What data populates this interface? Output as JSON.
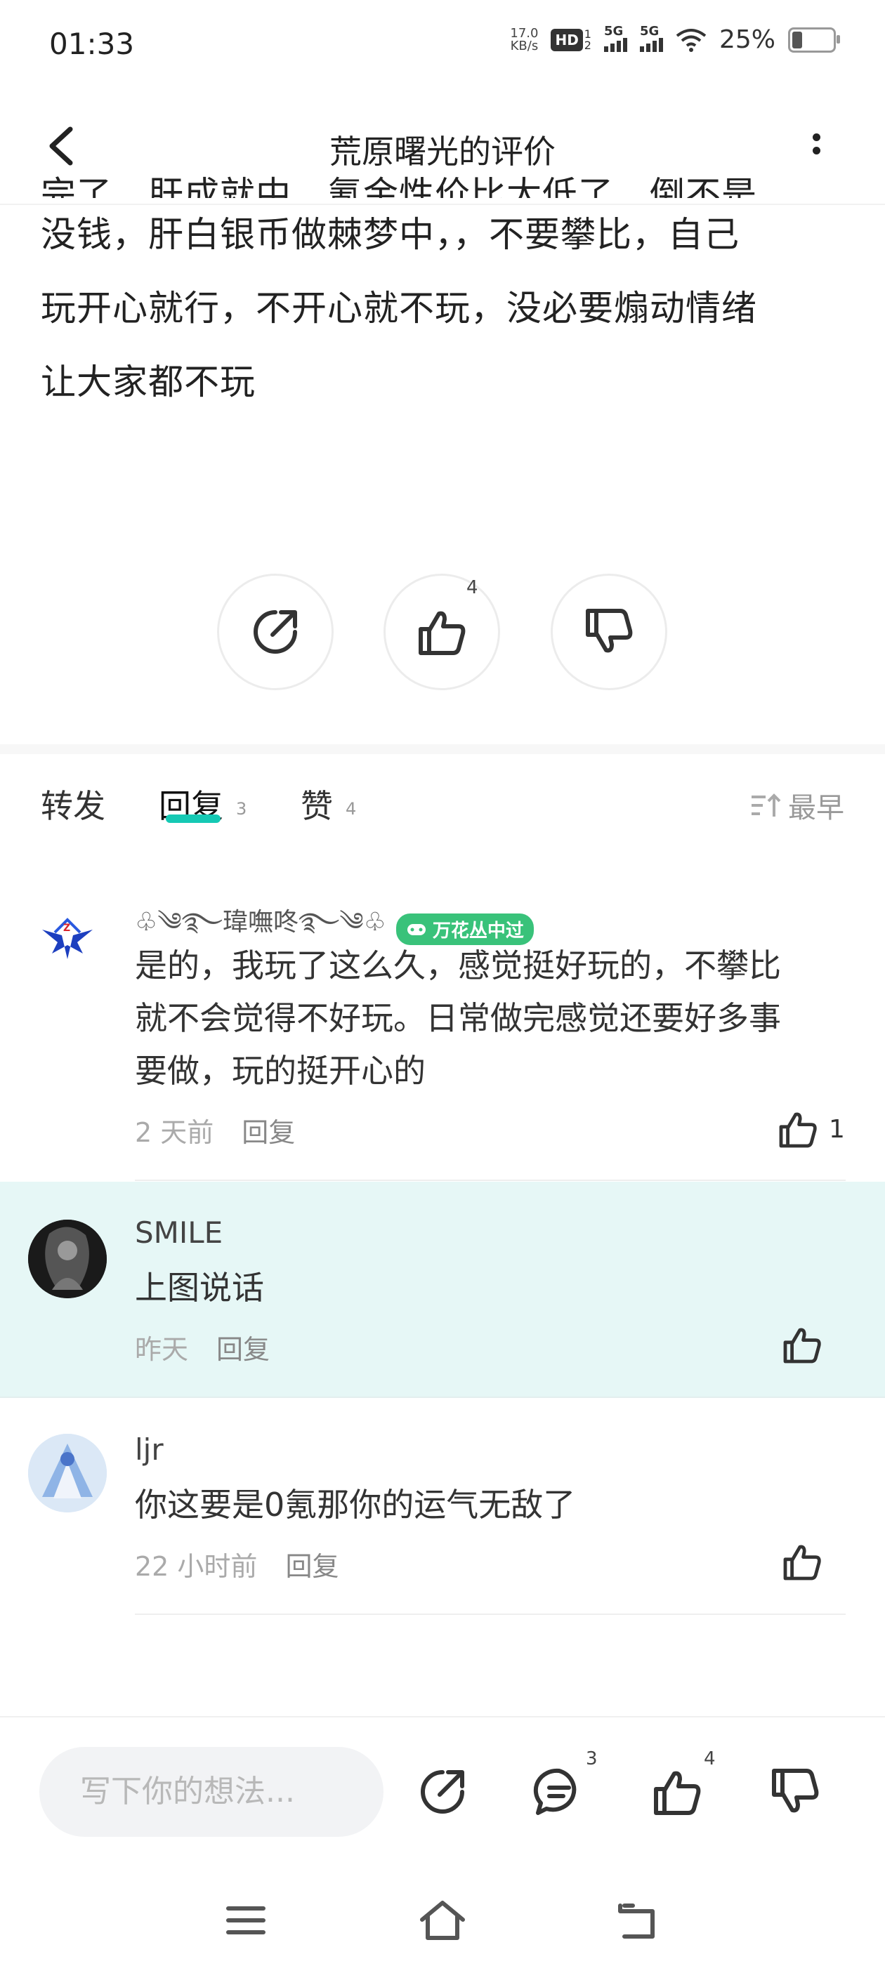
{
  "status_bar": {
    "time": "01:33",
    "net_speed_value": "17.0",
    "net_speed_unit": "KB/s",
    "hd_label": "HD",
    "hd_sub": "1",
    "hd_sub2": "2",
    "sim1": "5G",
    "sim2": "5G",
    "battery": "25%"
  },
  "header": {
    "title": "荒原曙光的评价",
    "back_icon": "chevron-left-icon",
    "more_icon": "more-vertical-icon"
  },
  "review": {
    "partial_line": "完了，肝成就中，氪金性价比太低了，倒不是",
    "lines": [
      "没钱，肝白银币做棘梦中，，不要攀比，自己",
      "玩开心就行，不开心就不玩，没必要煽动情绪",
      "让大家都不玩"
    ]
  },
  "actions": {
    "share_icon": "share-icon",
    "like_icon": "thumb-up-icon",
    "like_count": "4",
    "dislike_icon": "thumb-down-icon"
  },
  "tabs": {
    "items": [
      {
        "label": "转发",
        "count": ""
      },
      {
        "label": "回复",
        "count": "3"
      },
      {
        "label": "赞",
        "count": "4"
      }
    ],
    "active": 1,
    "accent": "#15c9b4",
    "sort_label": "最早",
    "sort_icon": "sort-icon"
  },
  "comments": [
    {
      "name": "♧༄࿐瑋嘸咚࿐༄♧",
      "badge": "万花丛中过",
      "badge_icon": "gamepad-icon",
      "badge_color": "#39c27a",
      "lines": [
        "是的，我玩了这么久，感觉挺好玩的，不攀比",
        "就不会觉得不好玩。日常做完感觉还要好多事",
        "要做，玩的挺开心的"
      ],
      "time": "2 天前",
      "reply": "回复",
      "likes": "1"
    },
    {
      "name": "SMILE",
      "lines": [
        "上图说话"
      ],
      "time": "昨天",
      "reply": "回复",
      "likes": "",
      "highlight_color": "#e6f7f6"
    },
    {
      "name": "ljr",
      "lines": [
        "你这要是0氪那你的运气无敌了"
      ],
      "time": "22 小时前",
      "reply": "回复",
      "likes": ""
    }
  ],
  "bottom_bar": {
    "placeholder": "写下你的想法...",
    "share_icon": "share-icon",
    "comment_icon": "comment-icon",
    "comment_count": "3",
    "like_icon": "thumb-up-icon",
    "like_count": "4",
    "dislike_icon": "thumb-down-icon"
  },
  "nav_bar": {
    "menu_icon": "menu-icon",
    "home_icon": "home-icon",
    "back_icon": "back-icon"
  }
}
